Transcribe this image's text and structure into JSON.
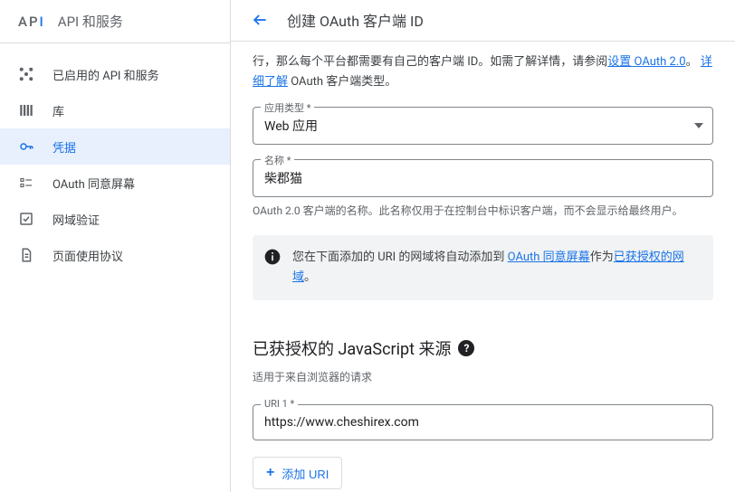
{
  "sidebar": {
    "logo_letters": "API",
    "product_title": "API 和服务",
    "items": [
      {
        "id": "enabled",
        "label": "已启用的 API 和服务"
      },
      {
        "id": "library",
        "label": "库"
      },
      {
        "id": "credentials",
        "label": "凭据"
      },
      {
        "id": "consent",
        "label": "OAuth 同意屏幕"
      },
      {
        "id": "domain-verify",
        "label": "网域验证"
      },
      {
        "id": "page-usage",
        "label": "页面使用协议"
      }
    ]
  },
  "header": {
    "page_title": "创建 OAuth 客户端 ID"
  },
  "intro": {
    "line1_prefix": "行，那么每个平台都需要有自己的客户端 ID。如需了解详情，请参阅",
    "link1": "设置 OAuth 2.0",
    "line1_mid": "。 ",
    "link2": "详细了解",
    "line1_suffix": " OAuth 客户端类型。"
  },
  "app_type": {
    "label": "应用类型 *",
    "value": "Web 应用"
  },
  "name": {
    "label": "名称 *",
    "value": "柴郡猫",
    "helper": "OAuth 2.0 客户端的名称。此名称仅用于在控制台中标识客户端，而不会显示给最终用户。"
  },
  "info_box": {
    "prefix": "您在下面添加的 URI 的网域将自动添加到 ",
    "link1": "OAuth 同意屏幕",
    "mid": "作为",
    "link2": "已获授权的网域",
    "suffix": "。"
  },
  "js_origins": {
    "title": "已获授权的 JavaScript 来源",
    "subtitle": "适用于来自浏览器的请求",
    "uri_label": "URI 1 *",
    "uri_value": "https://www.cheshirex.com",
    "add_label": "添加 URI"
  }
}
